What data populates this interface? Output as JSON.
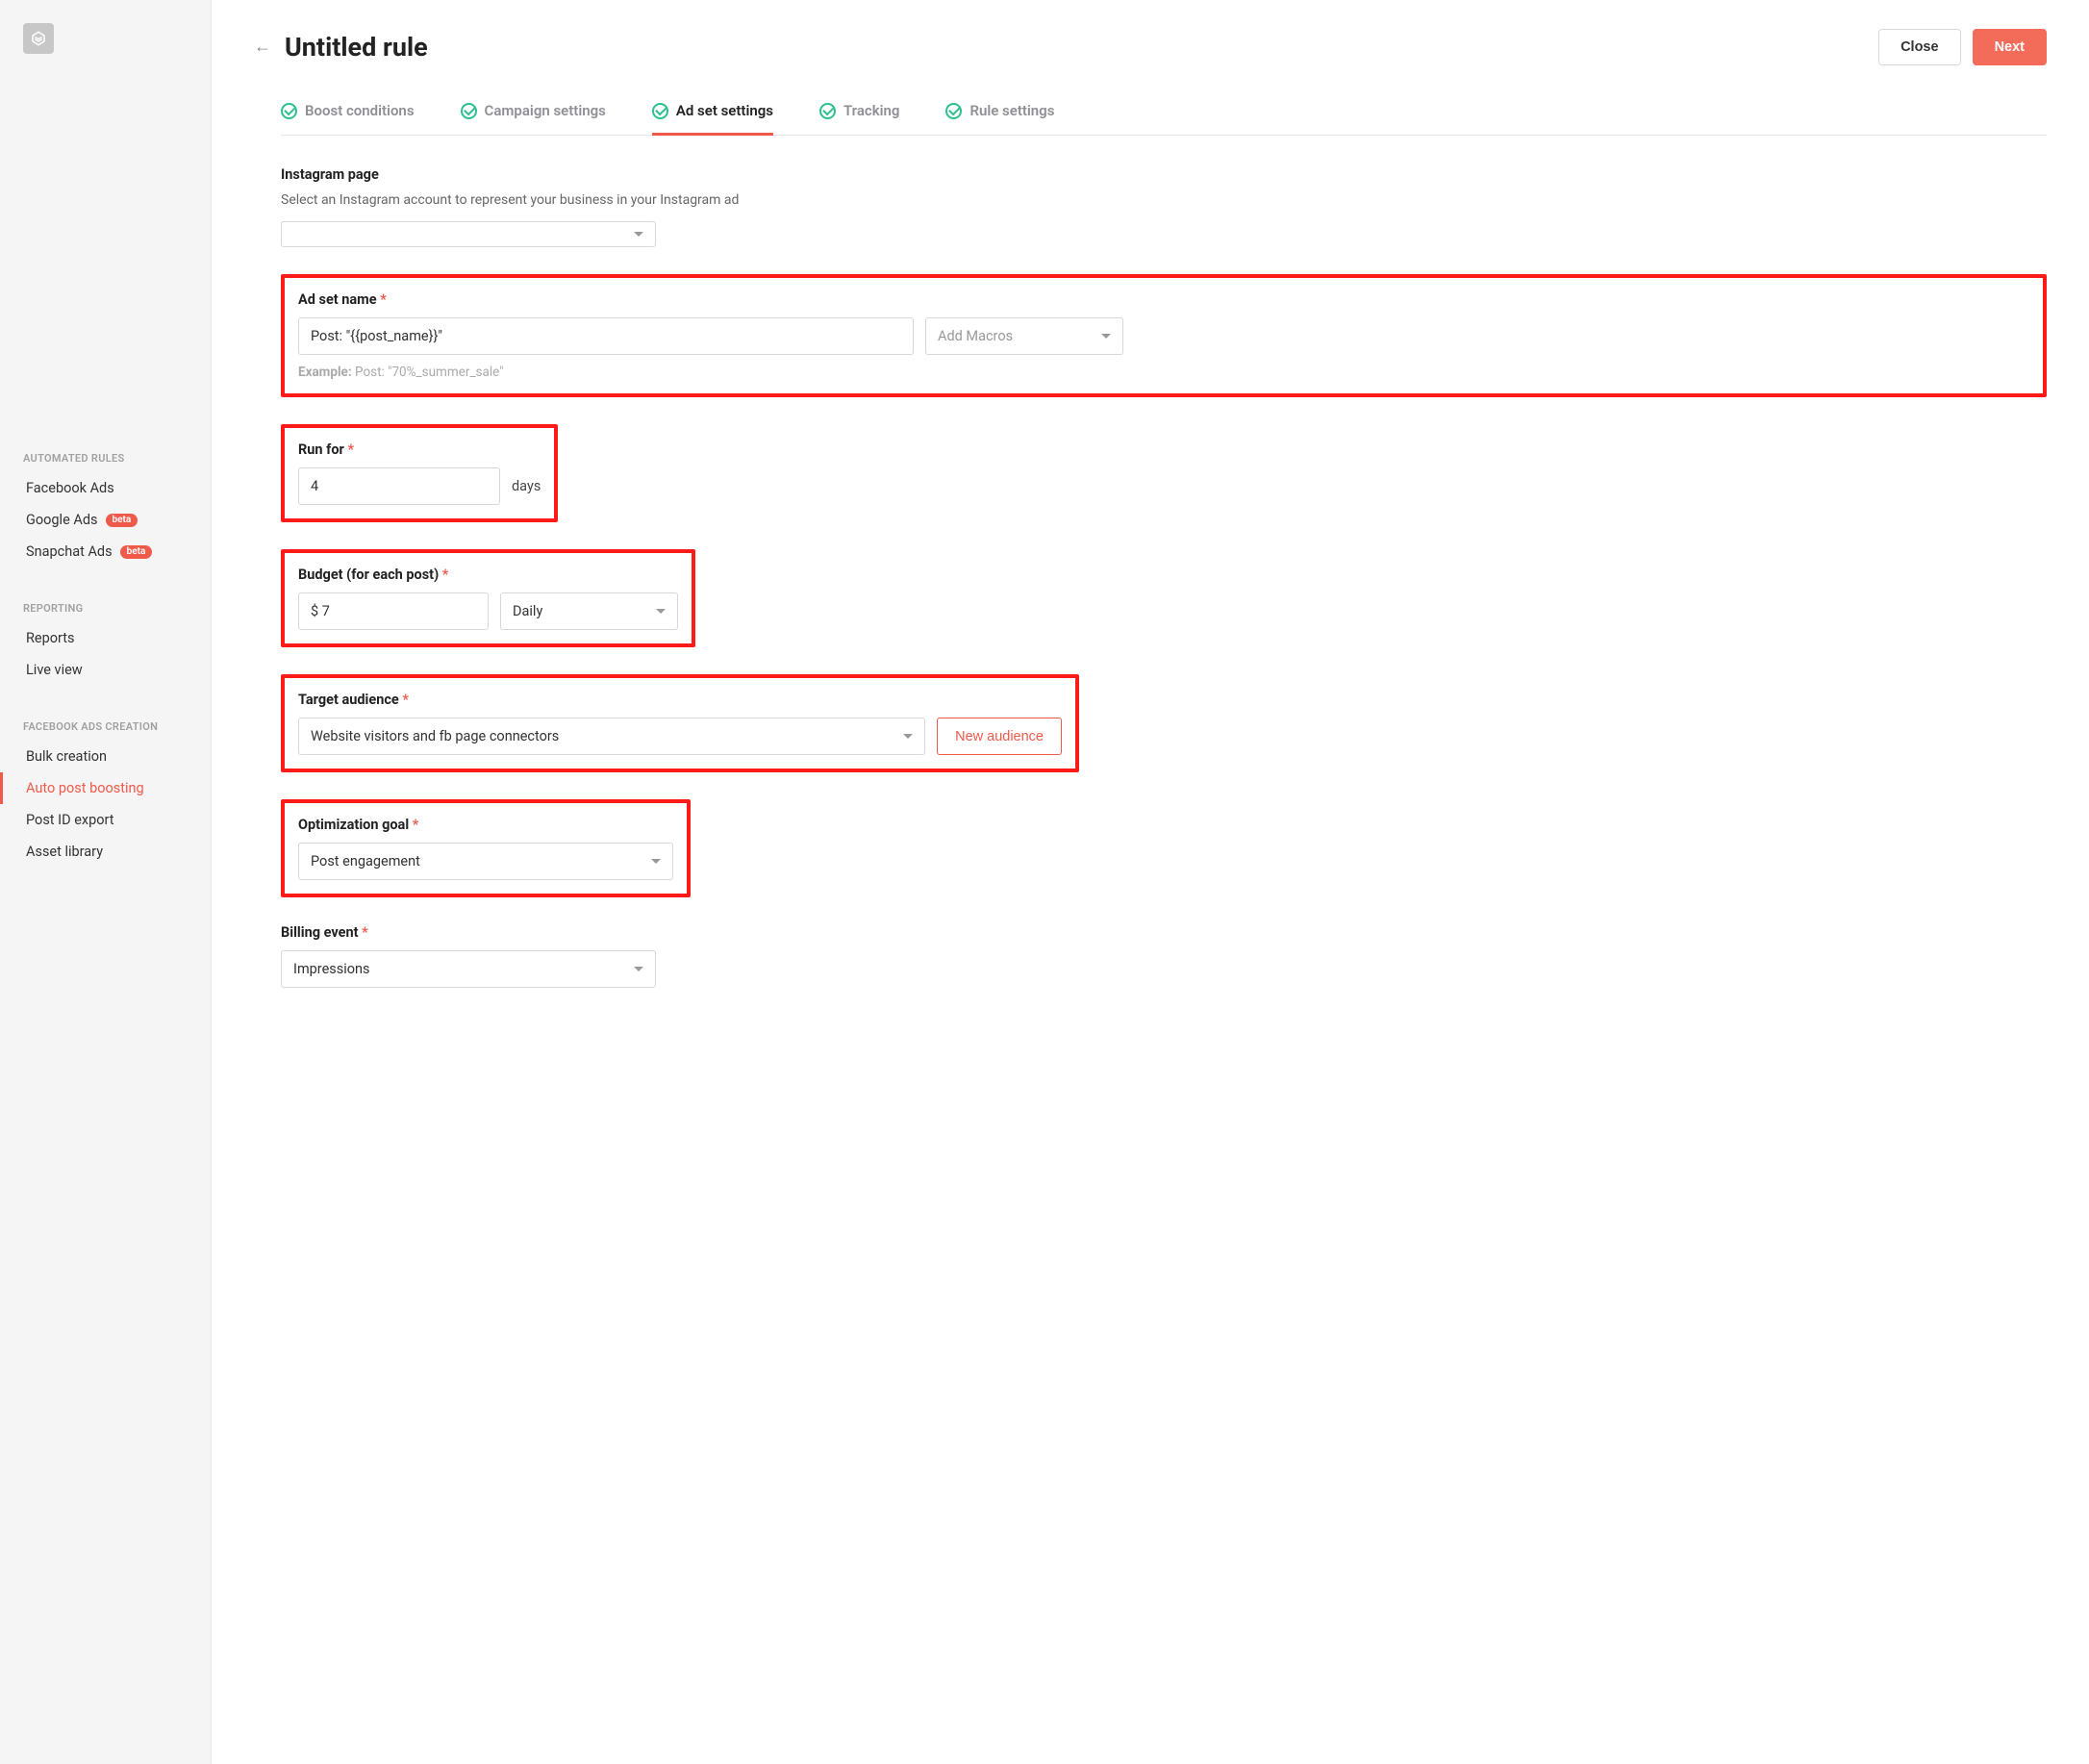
{
  "header": {
    "title": "Untitled rule",
    "close_label": "Close",
    "next_label": "Next"
  },
  "steps": {
    "boost": "Boost conditions",
    "campaign": "Campaign settings",
    "adset": "Ad set settings",
    "tracking": "Tracking",
    "rule": "Rule settings"
  },
  "sidebar": {
    "sections": {
      "automated_rules": {
        "heading": "AUTOMATED RULES",
        "items": [
          {
            "label": "Facebook Ads",
            "badge": null
          },
          {
            "label": "Google Ads",
            "badge": "beta"
          },
          {
            "label": "Snapchat Ads",
            "badge": "beta"
          }
        ]
      },
      "reporting": {
        "heading": "REPORTING",
        "items": [
          {
            "label": "Reports"
          },
          {
            "label": "Live view"
          }
        ]
      },
      "fb_ads_creation": {
        "heading": "FACEBOOK ADS CREATION",
        "items": [
          {
            "label": "Bulk creation"
          },
          {
            "label": "Auto post boosting",
            "active": true
          },
          {
            "label": "Post ID export"
          },
          {
            "label": "Asset library"
          }
        ]
      }
    }
  },
  "form": {
    "instagram": {
      "label": "Instagram page",
      "help": "Select an Instagram account to represent your business in your Instagram ad",
      "value": ""
    },
    "ad_set_name": {
      "label": "Ad set name",
      "value": "Post: \"{{post_name}}\"",
      "macros_placeholder": "Add Macros",
      "example_label": "Example:",
      "example_value": "Post: \"70%_summer_sale\""
    },
    "run_for": {
      "label": "Run for",
      "value": "4",
      "suffix": "days"
    },
    "budget": {
      "label": "Budget (for each post)",
      "value": "$ 7",
      "period": "Daily"
    },
    "target_audience": {
      "label": "Target audience",
      "value": "Website visitors and fb page connectors",
      "new_audience_label": "New audience"
    },
    "optimization_goal": {
      "label": "Optimization goal",
      "value": "Post engagement"
    },
    "billing_event": {
      "label": "Billing event",
      "value": "Impressions"
    }
  }
}
